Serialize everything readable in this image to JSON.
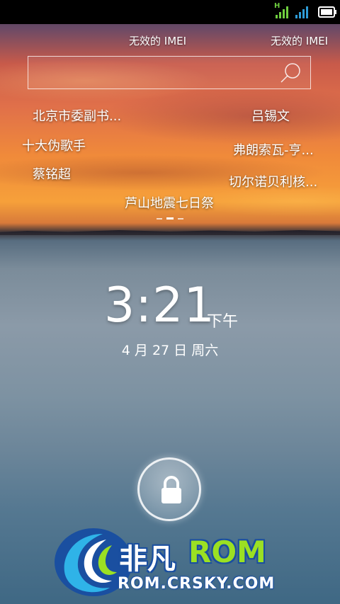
{
  "status_bar": {
    "network_type": "H",
    "icons": [
      "signal-strength-1-icon",
      "signal-strength-2-icon",
      "battery-icon"
    ],
    "colors": {
      "signal1": "#6fcf3f",
      "signal2": "#2e9bd6"
    }
  },
  "imei_labels": [
    "无效的 IMEI",
    "无效的 IMEI"
  ],
  "search": {
    "value": "",
    "icon": "search-icon"
  },
  "hot_tags": [
    {
      "label": "北京市委副书..."
    },
    {
      "label": "吕锡文"
    },
    {
      "label": "十大伪歌手"
    },
    {
      "label": "弗朗索瓦-亨..."
    },
    {
      "label": "蔡铭超"
    },
    {
      "label": "切尔诺贝利核..."
    },
    {
      "label": "芦山地震七日祭"
    }
  ],
  "pager": {
    "pages": 3,
    "current": 2
  },
  "clock": {
    "time": "3:21",
    "ampm": "下午",
    "date": "4 月 27 日 周六"
  },
  "lock": {
    "icon": "lock-icon"
  },
  "watermark": {
    "brand_cn": "非凡",
    "brand_en": "ROM",
    "url": "ROM.CRSKY.COM"
  }
}
